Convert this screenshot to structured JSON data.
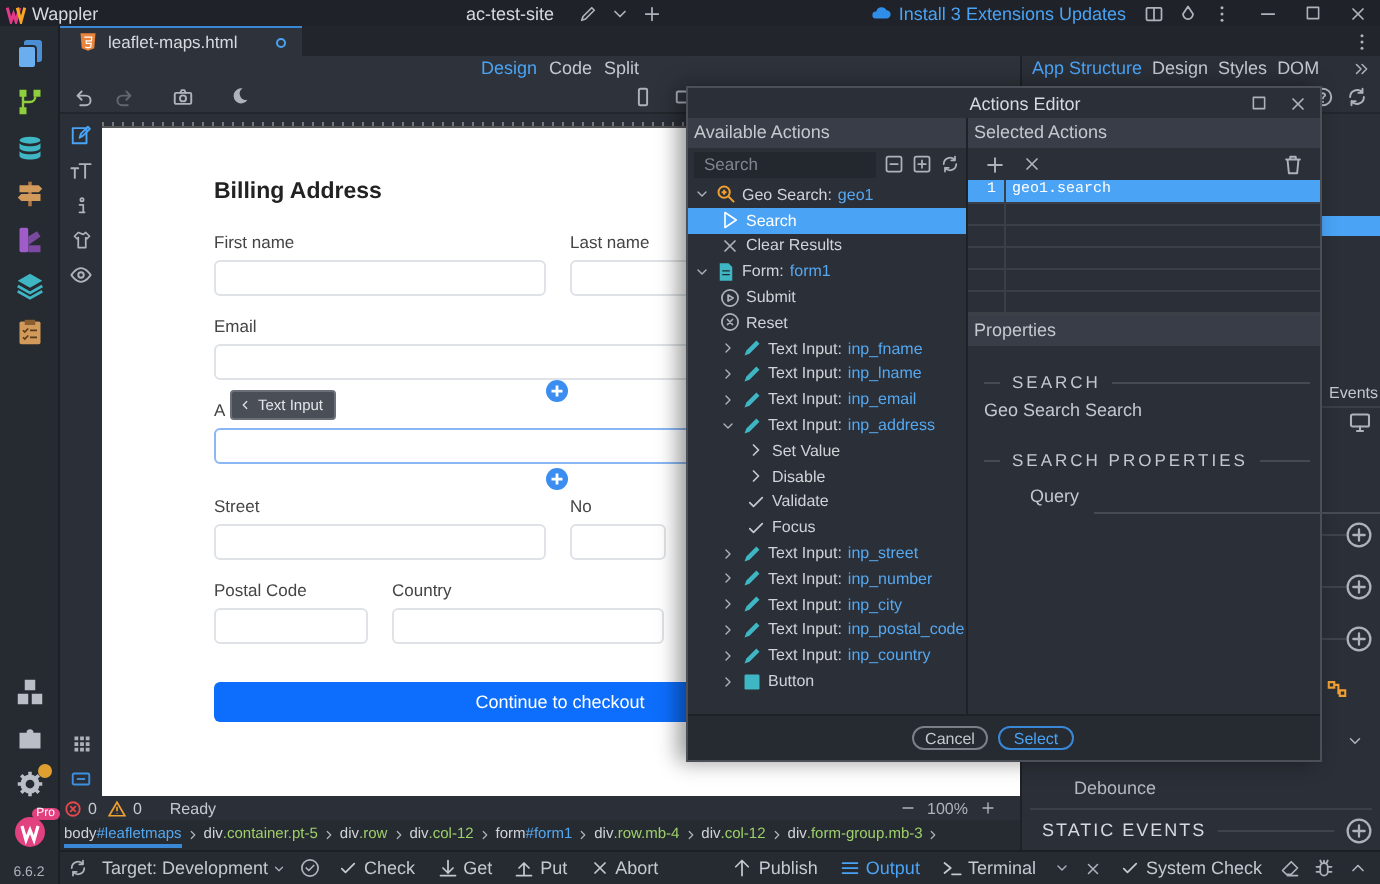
{
  "window": {
    "app_name": "Wappler",
    "project": "ac-test-site",
    "update_link": "Install 3 Extensions Updates"
  },
  "file_tabs": [
    {
      "label": "leaflet-maps.html",
      "selected": true,
      "modified": true
    }
  ],
  "view_modes": [
    {
      "label": "Design",
      "selected": true
    },
    {
      "label": "Code",
      "selected": false
    },
    {
      "label": "Split",
      "selected": false
    }
  ],
  "panel_tabs": [
    {
      "label": "App Structure",
      "selected": true
    },
    {
      "label": "Design",
      "selected": false
    },
    {
      "label": "Styles",
      "selected": false
    },
    {
      "label": "DOM",
      "selected": false
    }
  ],
  "form": {
    "title": "Billing Address",
    "rows": [
      [
        {
          "label": "First name",
          "selected": false
        },
        {
          "label": "Last name",
          "selected": false
        }
      ],
      [
        {
          "label": "Email",
          "selected": false
        }
      ],
      [
        {
          "label": "A",
          "selected": true
        }
      ],
      [
        {
          "label": "Street",
          "selected": false
        },
        {
          "label": "No",
          "selected": false
        }
      ],
      [
        {
          "label": "Postal Code",
          "selected": false
        },
        {
          "label": "Country",
          "selected": false
        }
      ]
    ],
    "tooltip": "Text Input",
    "submit_button": "Continue to checkout"
  },
  "actions_editor": {
    "title": "Actions Editor",
    "available": {
      "header": "Available Actions",
      "search_placeholder": "Search",
      "tree": [
        {
          "kind": "geo",
          "type": "Geo Search:",
          "name": "geo1",
          "expanded": true,
          "selected": false,
          "children": [
            {
              "kind": "run",
              "label": "Search",
              "selected": true
            },
            {
              "kind": "clear",
              "label": "Clear Results",
              "selected": false
            }
          ]
        },
        {
          "kind": "form",
          "type": "Form:",
          "name": "form1",
          "expanded": true,
          "selected": false,
          "children": [
            {
              "kind": "submit",
              "label": "Submit",
              "selected": false
            },
            {
              "kind": "reset",
              "label": "Reset",
              "selected": false
            },
            {
              "kind": "input",
              "type": "Text Input:",
              "name": "inp_fname",
              "expanded": false,
              "selected": false
            },
            {
              "kind": "input",
              "type": "Text Input:",
              "name": "inp_lname",
              "expanded": false,
              "selected": false
            },
            {
              "kind": "input",
              "type": "Text Input:",
              "name": "inp_email",
              "expanded": false,
              "selected": false
            },
            {
              "kind": "input",
              "type": "Text Input:",
              "name": "inp_address",
              "expanded": true,
              "selected": false,
              "children": [
                {
                  "kind": "option",
                  "label": "Set Value",
                  "selected": false
                },
                {
                  "kind": "option",
                  "label": "Disable",
                  "selected": false
                },
                {
                  "kind": "check",
                  "label": "Validate",
                  "selected": false
                },
                {
                  "kind": "check",
                  "label": "Focus",
                  "selected": false
                }
              ]
            },
            {
              "kind": "input",
              "type": "Text Input:",
              "name": "inp_street",
              "expanded": false,
              "selected": false
            },
            {
              "kind": "input",
              "type": "Text Input:",
              "name": "inp_number",
              "expanded": false,
              "selected": false
            },
            {
              "kind": "input",
              "type": "Text Input:",
              "name": "inp_city",
              "expanded": false,
              "selected": false
            },
            {
              "kind": "input",
              "type": "Text Input:",
              "name": "inp_postal_code",
              "expanded": false,
              "selected": false
            },
            {
              "kind": "input",
              "type": "Text Input:",
              "name": "inp_country",
              "expanded": false,
              "selected": false
            },
            {
              "kind": "button",
              "label": "Button",
              "expanded": false,
              "selected": false
            }
          ]
        }
      ]
    },
    "selected": {
      "header": "Selected Actions",
      "rows": [
        {
          "number": "1",
          "action": "geo1.search",
          "selected": true
        }
      ]
    },
    "properties": {
      "header": "Properties",
      "sections": [
        {
          "title": "SEARCH",
          "description": "Geo Search Search"
        },
        {
          "title": "SEARCH PROPERTIES",
          "fields": [
            {
              "label": "Query"
            }
          ]
        }
      ]
    },
    "buttons": [
      {
        "label": "Cancel",
        "kind": "secondary"
      },
      {
        "label": "Select",
        "kind": "primary"
      }
    ]
  },
  "right_panel": {
    "events_tab": "Events",
    "debounce_label": "Debounce",
    "static_events_title": "STATIC EVENTS"
  },
  "status": {
    "errors": "0",
    "warnings": "0",
    "state": "Ready",
    "zoom": "100%"
  },
  "breadcrumb": [
    {
      "tag": "body",
      "rest": "#leafletmaps",
      "selected": true
    },
    {
      "tag": "div",
      "rest": ".container.pt-5",
      "selected": false
    },
    {
      "tag": "div",
      "rest": ".row",
      "selected": false
    },
    {
      "tag": "div",
      "rest": ".col-12",
      "selected": false
    },
    {
      "tag": "form",
      "rest": "#form1",
      "selected": false
    },
    {
      "tag": "div",
      "rest": ".row.mb-4",
      "selected": false
    },
    {
      "tag": "div",
      "rest": ".col-12",
      "selected": false
    },
    {
      "tag": "div",
      "rest": ".form-group.mb-3",
      "selected": false
    }
  ],
  "bottom_bar": {
    "target": "Target: Development",
    "left_items": [
      {
        "kind": "check",
        "label": "Check"
      },
      {
        "kind": "get",
        "label": "Get"
      },
      {
        "kind": "put",
        "label": "Put"
      },
      {
        "kind": "abort",
        "label": "Abort"
      }
    ],
    "right_items": [
      {
        "kind": "publish",
        "label": "Publish",
        "selected": false
      },
      {
        "kind": "output",
        "label": "Output",
        "selected": true
      },
      {
        "kind": "terminal",
        "label": "Terminal",
        "selected": false
      }
    ],
    "system_check": "System Check"
  },
  "rail": {
    "pro_badge": "Pro",
    "version": "6.6.2"
  }
}
